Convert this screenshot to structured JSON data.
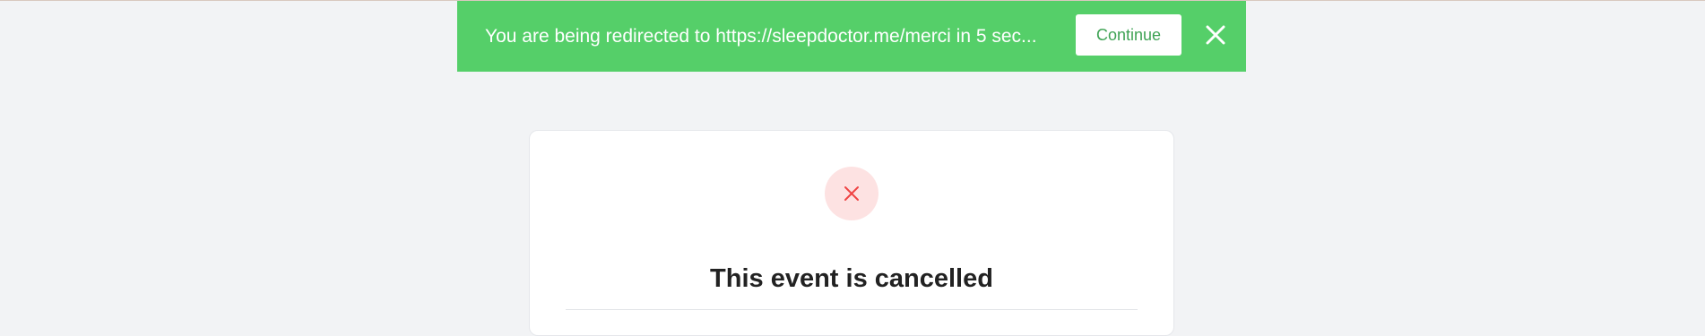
{
  "banner": {
    "message": "You are being redirected to https://sleepdoctor.me/merci in 5 sec...",
    "continue_label": "Continue",
    "close_icon": "close-icon",
    "background_color": "#55cf69"
  },
  "card": {
    "status_icon": "close-icon",
    "title": "This event is cancelled"
  },
  "colors": {
    "page_background": "#f2f3f5",
    "status_icon": "#ef4444",
    "status_circle": "#fde2e2"
  }
}
